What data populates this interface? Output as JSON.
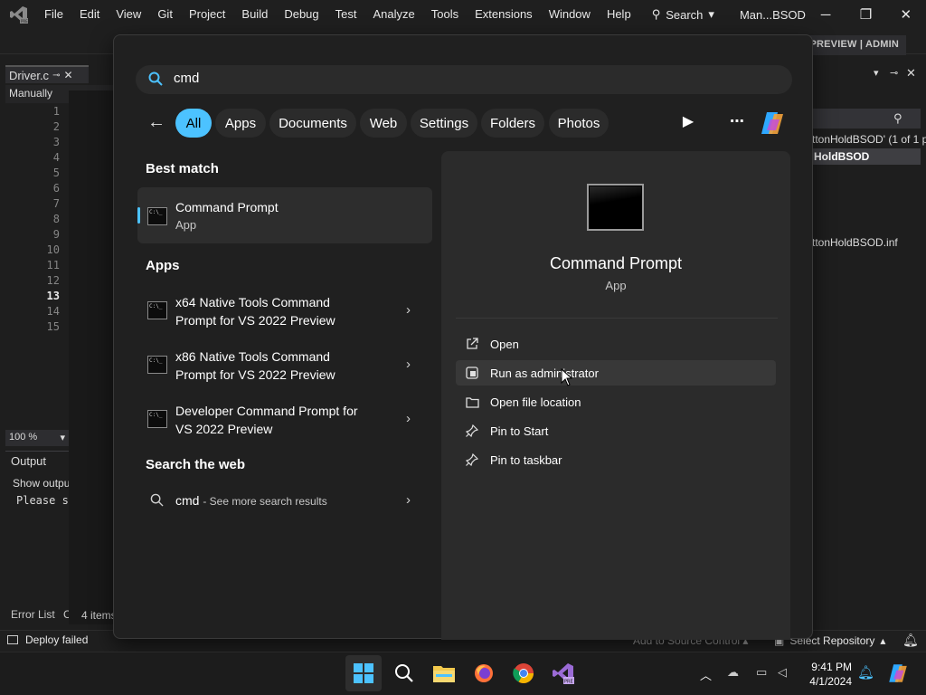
{
  "vs": {
    "menu": [
      "File",
      "Edit",
      "View",
      "Git",
      "Project",
      "Build",
      "Debug",
      "Test",
      "Analyze",
      "Tools",
      "Extensions",
      "Window",
      "Help"
    ],
    "search_label": "Search",
    "solution_name": "Man...BSOD",
    "preview_badge": "PREVIEW | ADMIN",
    "doc_tab": "Driver.c",
    "nav_bar": "Manually",
    "line_numbers": [
      "1",
      "2",
      "3",
      "4",
      "5",
      "6",
      "7",
      "8",
      "9",
      "10",
      "11",
      "12",
      "13",
      "14",
      "15"
    ],
    "zoom": "100 %",
    "output_title": "Output",
    "output_show": "Show outpu",
    "output_line": "Please s",
    "error_list_tab": "Error List",
    "error_list_tab2": "C",
    "explorer_items": "4 items",
    "solution_line1": "ttonHoldBSOD' (1 of 1 p",
    "solution_line2": "HoldBSOD",
    "solution_line3": "ttonHoldBSOD.inf",
    "status_deploy": "Deploy failed",
    "status_source_control": "Add to Source Control",
    "status_repo": "Select Repository"
  },
  "start_search": {
    "query": "cmd",
    "filters": [
      {
        "label": "All",
        "active": true
      },
      {
        "label": "Apps",
        "active": false
      },
      {
        "label": "Documents",
        "active": false
      },
      {
        "label": "Web",
        "active": false
      },
      {
        "label": "Settings",
        "active": false
      },
      {
        "label": "Folders",
        "active": false
      },
      {
        "label": "Photos",
        "active": false
      }
    ],
    "best_match_title": "Best match",
    "best_match": {
      "name": "Command Prompt",
      "type": "App"
    },
    "apps_title": "Apps",
    "apps": [
      {
        "line1": "x64 Native Tools Command",
        "line2": "Prompt for VS 2022 Preview"
      },
      {
        "line1": "x86 Native Tools Command",
        "line2": "Prompt for VS 2022 Preview"
      },
      {
        "line1": "Developer Command Prompt for",
        "line2": "VS 2022 Preview"
      }
    ],
    "web_title": "Search the web",
    "web_result": {
      "query": "cmd",
      "suffix": "- See more search results"
    },
    "preview": {
      "name": "Command Prompt",
      "type": "App",
      "actions": [
        {
          "label": "Open",
          "icon": "open-external-icon"
        },
        {
          "label": "Run as administrator",
          "icon": "shield-admin-icon",
          "hover": true
        },
        {
          "label": "Open file location",
          "icon": "folder-icon"
        },
        {
          "label": "Pin to Start",
          "icon": "pin-icon"
        },
        {
          "label": "Pin to taskbar",
          "icon": "pin-icon"
        }
      ]
    }
  },
  "taskbar": {
    "time": "9:41 PM",
    "date": "4/1/2024"
  },
  "colors": {
    "accent": "#4cc2ff",
    "flyout_bg": "#202020",
    "preview_bg": "#2b2b2b"
  }
}
